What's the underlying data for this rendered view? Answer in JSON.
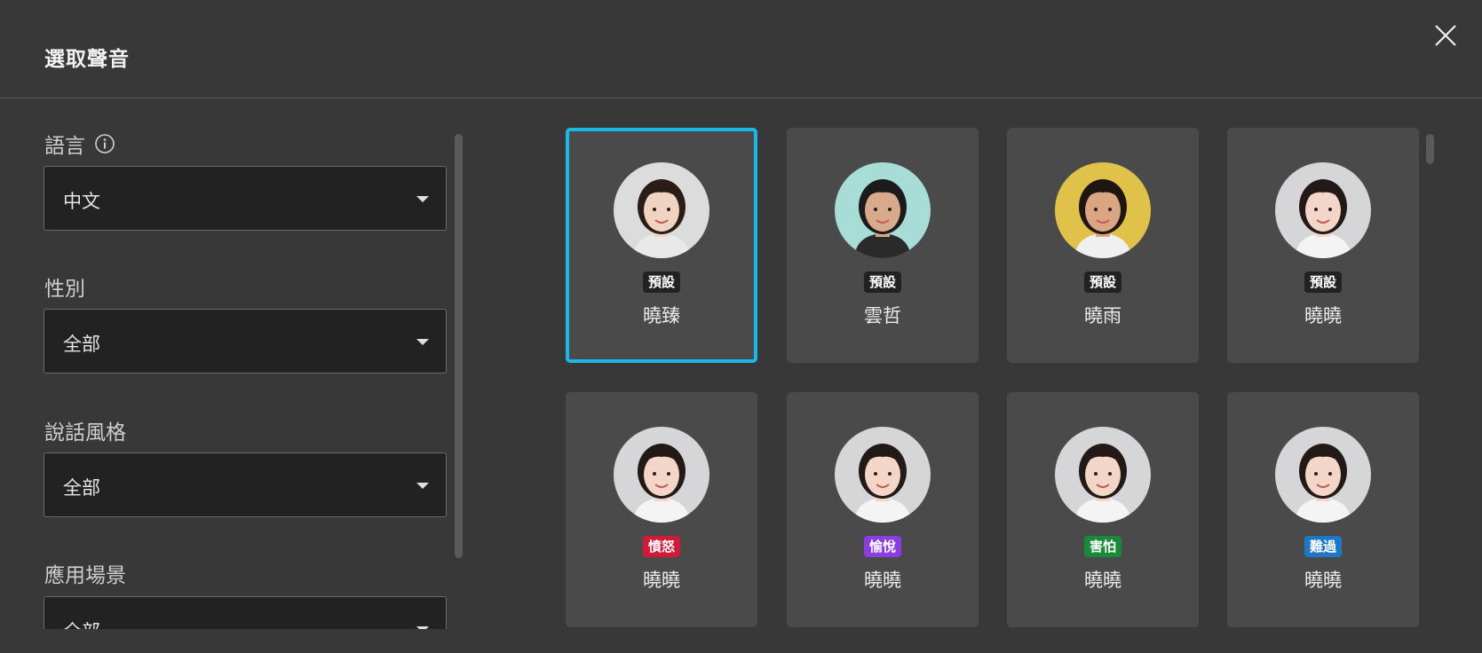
{
  "dialog": {
    "title": "選取聲音"
  },
  "filters": {
    "language": {
      "label": "語言",
      "value": "中文"
    },
    "gender": {
      "label": "性別",
      "value": "全部"
    },
    "style": {
      "label": "說話風格",
      "value": "全部"
    },
    "scenario": {
      "label": "應用場景",
      "value": "全部"
    }
  },
  "voices": [
    {
      "name": "曉臻",
      "badge": "預設",
      "badge_color": "#222222",
      "avatar_bg": "#dcdcdc",
      "hair": "#2a1d18",
      "skin": "#f1d3c2",
      "shirt": "#e9e9e9",
      "selected": true
    },
    {
      "name": "雲哲",
      "badge": "預設",
      "badge_color": "#222222",
      "avatar_bg": "#a8dcd6",
      "hair": "#1b1b1b",
      "skin": "#d9a98c",
      "shirt": "#2a2a2a",
      "selected": false
    },
    {
      "name": "曉雨",
      "badge": "預設",
      "badge_color": "#222222",
      "avatar_bg": "#e0c24a",
      "hair": "#1f1611",
      "skin": "#d9a582",
      "shirt": "#f0f0f0",
      "selected": false
    },
    {
      "name": "曉曉",
      "badge": "預設",
      "badge_color": "#222222",
      "avatar_bg": "#d6d6d8",
      "hair": "#231a18",
      "skin": "#f3d6c8",
      "shirt": "#f4f4f4",
      "selected": false
    },
    {
      "name": "曉曉",
      "badge": "憤怒",
      "badge_color": "#d11a3a",
      "avatar_bg": "#d6d6d8",
      "hair": "#231a18",
      "skin": "#f3d6c8",
      "shirt": "#f4f4f4",
      "selected": false
    },
    {
      "name": "曉曉",
      "badge": "愉悅",
      "badge_color": "#8a3de0",
      "avatar_bg": "#d6d6d8",
      "hair": "#231a18",
      "skin": "#f3d6c8",
      "shirt": "#f4f4f4",
      "selected": false
    },
    {
      "name": "曉曉",
      "badge": "害怕",
      "badge_color": "#1a8a3a",
      "avatar_bg": "#d6d6d8",
      "hair": "#231a18",
      "skin": "#f3d6c8",
      "shirt": "#f4f4f4",
      "selected": false
    },
    {
      "name": "曉曉",
      "badge": "難過",
      "badge_color": "#1f78c4",
      "avatar_bg": "#d6d6d8",
      "hair": "#231a18",
      "skin": "#f3d6c8",
      "shirt": "#f4f4f4",
      "selected": false
    }
  ],
  "colors": {
    "accent": "#1ab8e8",
    "background": "#383838",
    "card": "#4a4a4a"
  },
  "icons": {
    "close": "close-icon",
    "info": "info-icon",
    "dropdown": "caret-down-icon"
  }
}
